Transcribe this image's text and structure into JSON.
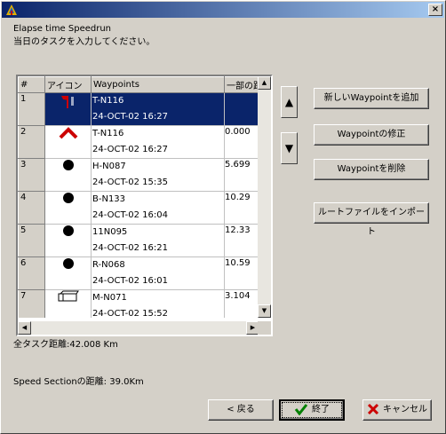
{
  "window": {
    "close_label": "×",
    "heading_line1": "Elapse time Speedrun",
    "heading_line2": "当日のタスクを入力してください。"
  },
  "grid": {
    "columns": [
      "#",
      "アイコン",
      "Waypoints",
      "一部の距"
    ],
    "rows": [
      {
        "num": "1",
        "icon": "flag-icon",
        "name": "T-N116",
        "time": "24-OCT-02 16:27",
        "distance": "",
        "selected": true
      },
      {
        "num": "2",
        "icon": "chevron-up-icon",
        "name": "T-N116",
        "time": "24-OCT-02 16:27",
        "distance": "0.000",
        "selected": false
      },
      {
        "num": "3",
        "icon": "dot-icon",
        "name": "H-N087",
        "time": "24-OCT-02 15:35",
        "distance": "5.699",
        "selected": false
      },
      {
        "num": "4",
        "icon": "dot-icon",
        "name": "B-N133",
        "time": "24-OCT-02 16:04",
        "distance": "10.29",
        "selected": false
      },
      {
        "num": "5",
        "icon": "dot-icon",
        "name": "11N095",
        "time": "24-OCT-02 16:21",
        "distance": "12.33",
        "selected": false
      },
      {
        "num": "6",
        "icon": "dot-icon",
        "name": "R-N068",
        "time": "24-OCT-02 16:01",
        "distance": "10.59",
        "selected": false
      },
      {
        "num": "7",
        "icon": "box-icon",
        "name": "M-N071",
        "time": "24-OCT-02 15:52",
        "distance": "3.104",
        "selected": false
      }
    ]
  },
  "buttons": {
    "move_up": "▲",
    "move_down": "▼",
    "add_waypoint": "新しいWaypointを追加",
    "edit_waypoint": "Waypointの修正",
    "delete_waypoint": "Waypointを削除",
    "import_route": "ルートファイルをインポート",
    "back": "< 戻る",
    "finish": "終了",
    "cancel": "キャンセル"
  },
  "summary": {
    "total_distance": "全タスク距離:42.008 Km",
    "speed_section": "Speed Sectionの距離: 39.0Km"
  },
  "colors": {
    "selection": "#0a246a",
    "finish_check": "#008000",
    "cancel_x": "#cc0000",
    "icon_red": "#cc0000"
  }
}
